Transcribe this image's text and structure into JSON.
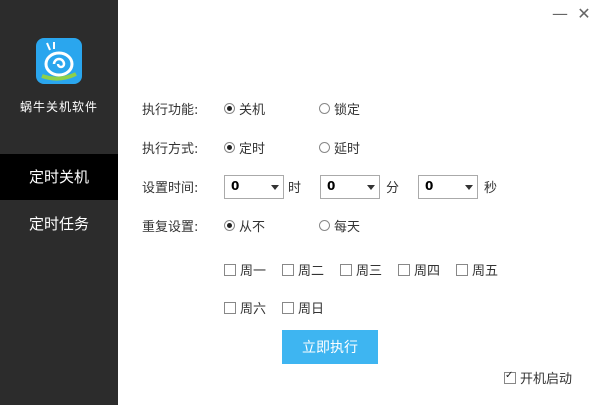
{
  "window": {
    "minimize_icon": "—",
    "close_icon": "✕"
  },
  "sidebar": {
    "app_name": "蜗牛关机软件",
    "items": [
      {
        "label": "定时关机",
        "active": true
      },
      {
        "label": "定时任务",
        "active": false
      }
    ]
  },
  "form": {
    "function": {
      "label": "执行功能:",
      "options": [
        "关机",
        "锁定"
      ],
      "selected": "关机"
    },
    "mode": {
      "label": "执行方式:",
      "options": [
        "定时",
        "延时"
      ],
      "selected": "定时"
    },
    "time": {
      "label": "设置时间:",
      "hour": "0",
      "hour_unit": "时",
      "minute": "0",
      "minute_unit": "分",
      "second": "0",
      "second_unit": "秒"
    },
    "repeat": {
      "label": "重复设置:",
      "options": [
        "从不",
        "每天"
      ],
      "selected": "从不"
    },
    "weekdays": [
      "周一",
      "周二",
      "周三",
      "周四",
      "周五",
      "周六",
      "周日"
    ]
  },
  "execute_label": "立即执行",
  "startup": {
    "label": "开机启动",
    "checked": true
  },
  "colors": {
    "sidebar_bg": "#2c2c2c",
    "active_nav_bg": "#000000",
    "accent": "#3eb5f1"
  }
}
